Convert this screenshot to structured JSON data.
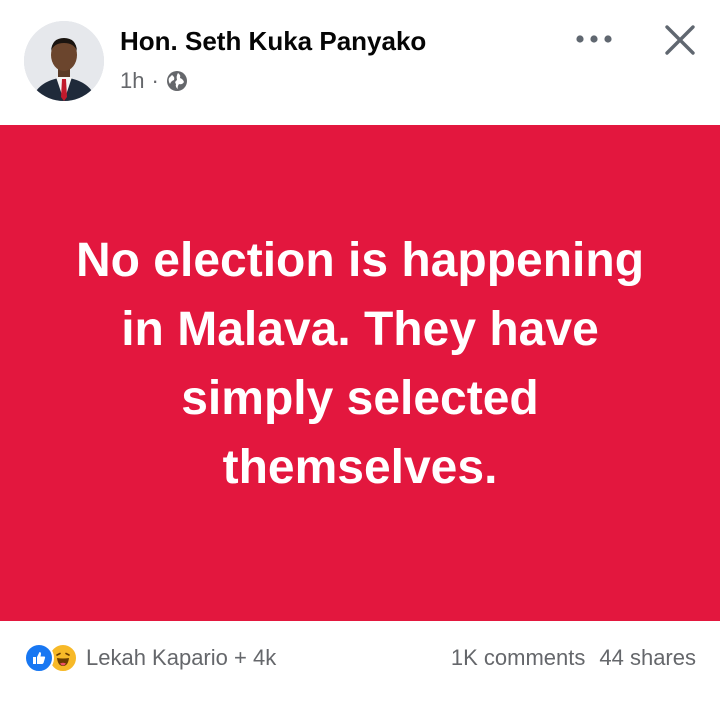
{
  "post": {
    "author": "Hon. Seth Kuka Panyako",
    "time": "1h",
    "separator": "·",
    "audience_icon": "globe-icon",
    "card_text": "No election is happening in Malava. They have simply selected themselves.",
    "card_background": "#e3173e",
    "card_text_color": "#ffffff"
  },
  "header": {
    "more_icon": "more-options-icon",
    "close_icon": "close-icon"
  },
  "footer": {
    "reaction_icons": [
      "like-icon",
      "haha-icon"
    ],
    "reactors": "Lekah Kapario + 4k",
    "comments": "1K comments",
    "shares": "44 shares"
  },
  "colors": {
    "like_blue": "#1877f2",
    "haha_yellow": "#f7b928",
    "secondary_text": "#65676b"
  }
}
